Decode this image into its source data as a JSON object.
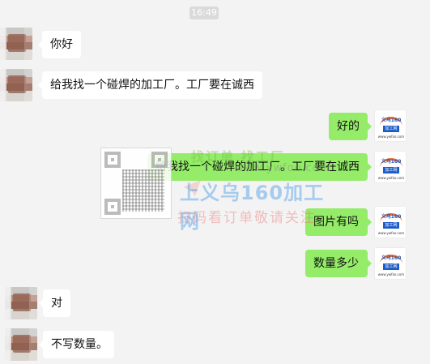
{
  "chat": {
    "time": "16:49",
    "messages": [
      {
        "side": "left",
        "text": "你好"
      },
      {
        "side": "left",
        "text": "给我找一个碰焊的加工厂。工厂要在诚西"
      },
      {
        "side": "right",
        "text": "好的"
      },
      {
        "side": "right",
        "text": "给我找一个碰焊的加工厂。工厂要在诚西"
      },
      {
        "side": "right",
        "text": "图片有吗"
      },
      {
        "side": "right",
        "text": "数量多少"
      },
      {
        "side": "left",
        "text": "对"
      },
      {
        "side": "left",
        "text": "不写数量。"
      }
    ],
    "bot_avatar": {
      "title": "义乌160",
      "badge": "加工网",
      "url": "www.ywfoo.com"
    }
  },
  "watermark": {
    "top_text": "找订单 找工厂",
    "url": "www.ywfoo.com",
    "main_text": "上义乌160加工网",
    "bottom_text": "扫码看订单敬请关注"
  },
  "colors": {
    "background": "#f3f3f3",
    "left_bubble": "#ffffff",
    "right_bubble": "#95ec69",
    "time_badge": "#dadada"
  },
  "icons": {
    "user_avatar": "avatar",
    "bot_avatar": "logo-avatar",
    "watermark_qr": "qr-code-icon"
  }
}
